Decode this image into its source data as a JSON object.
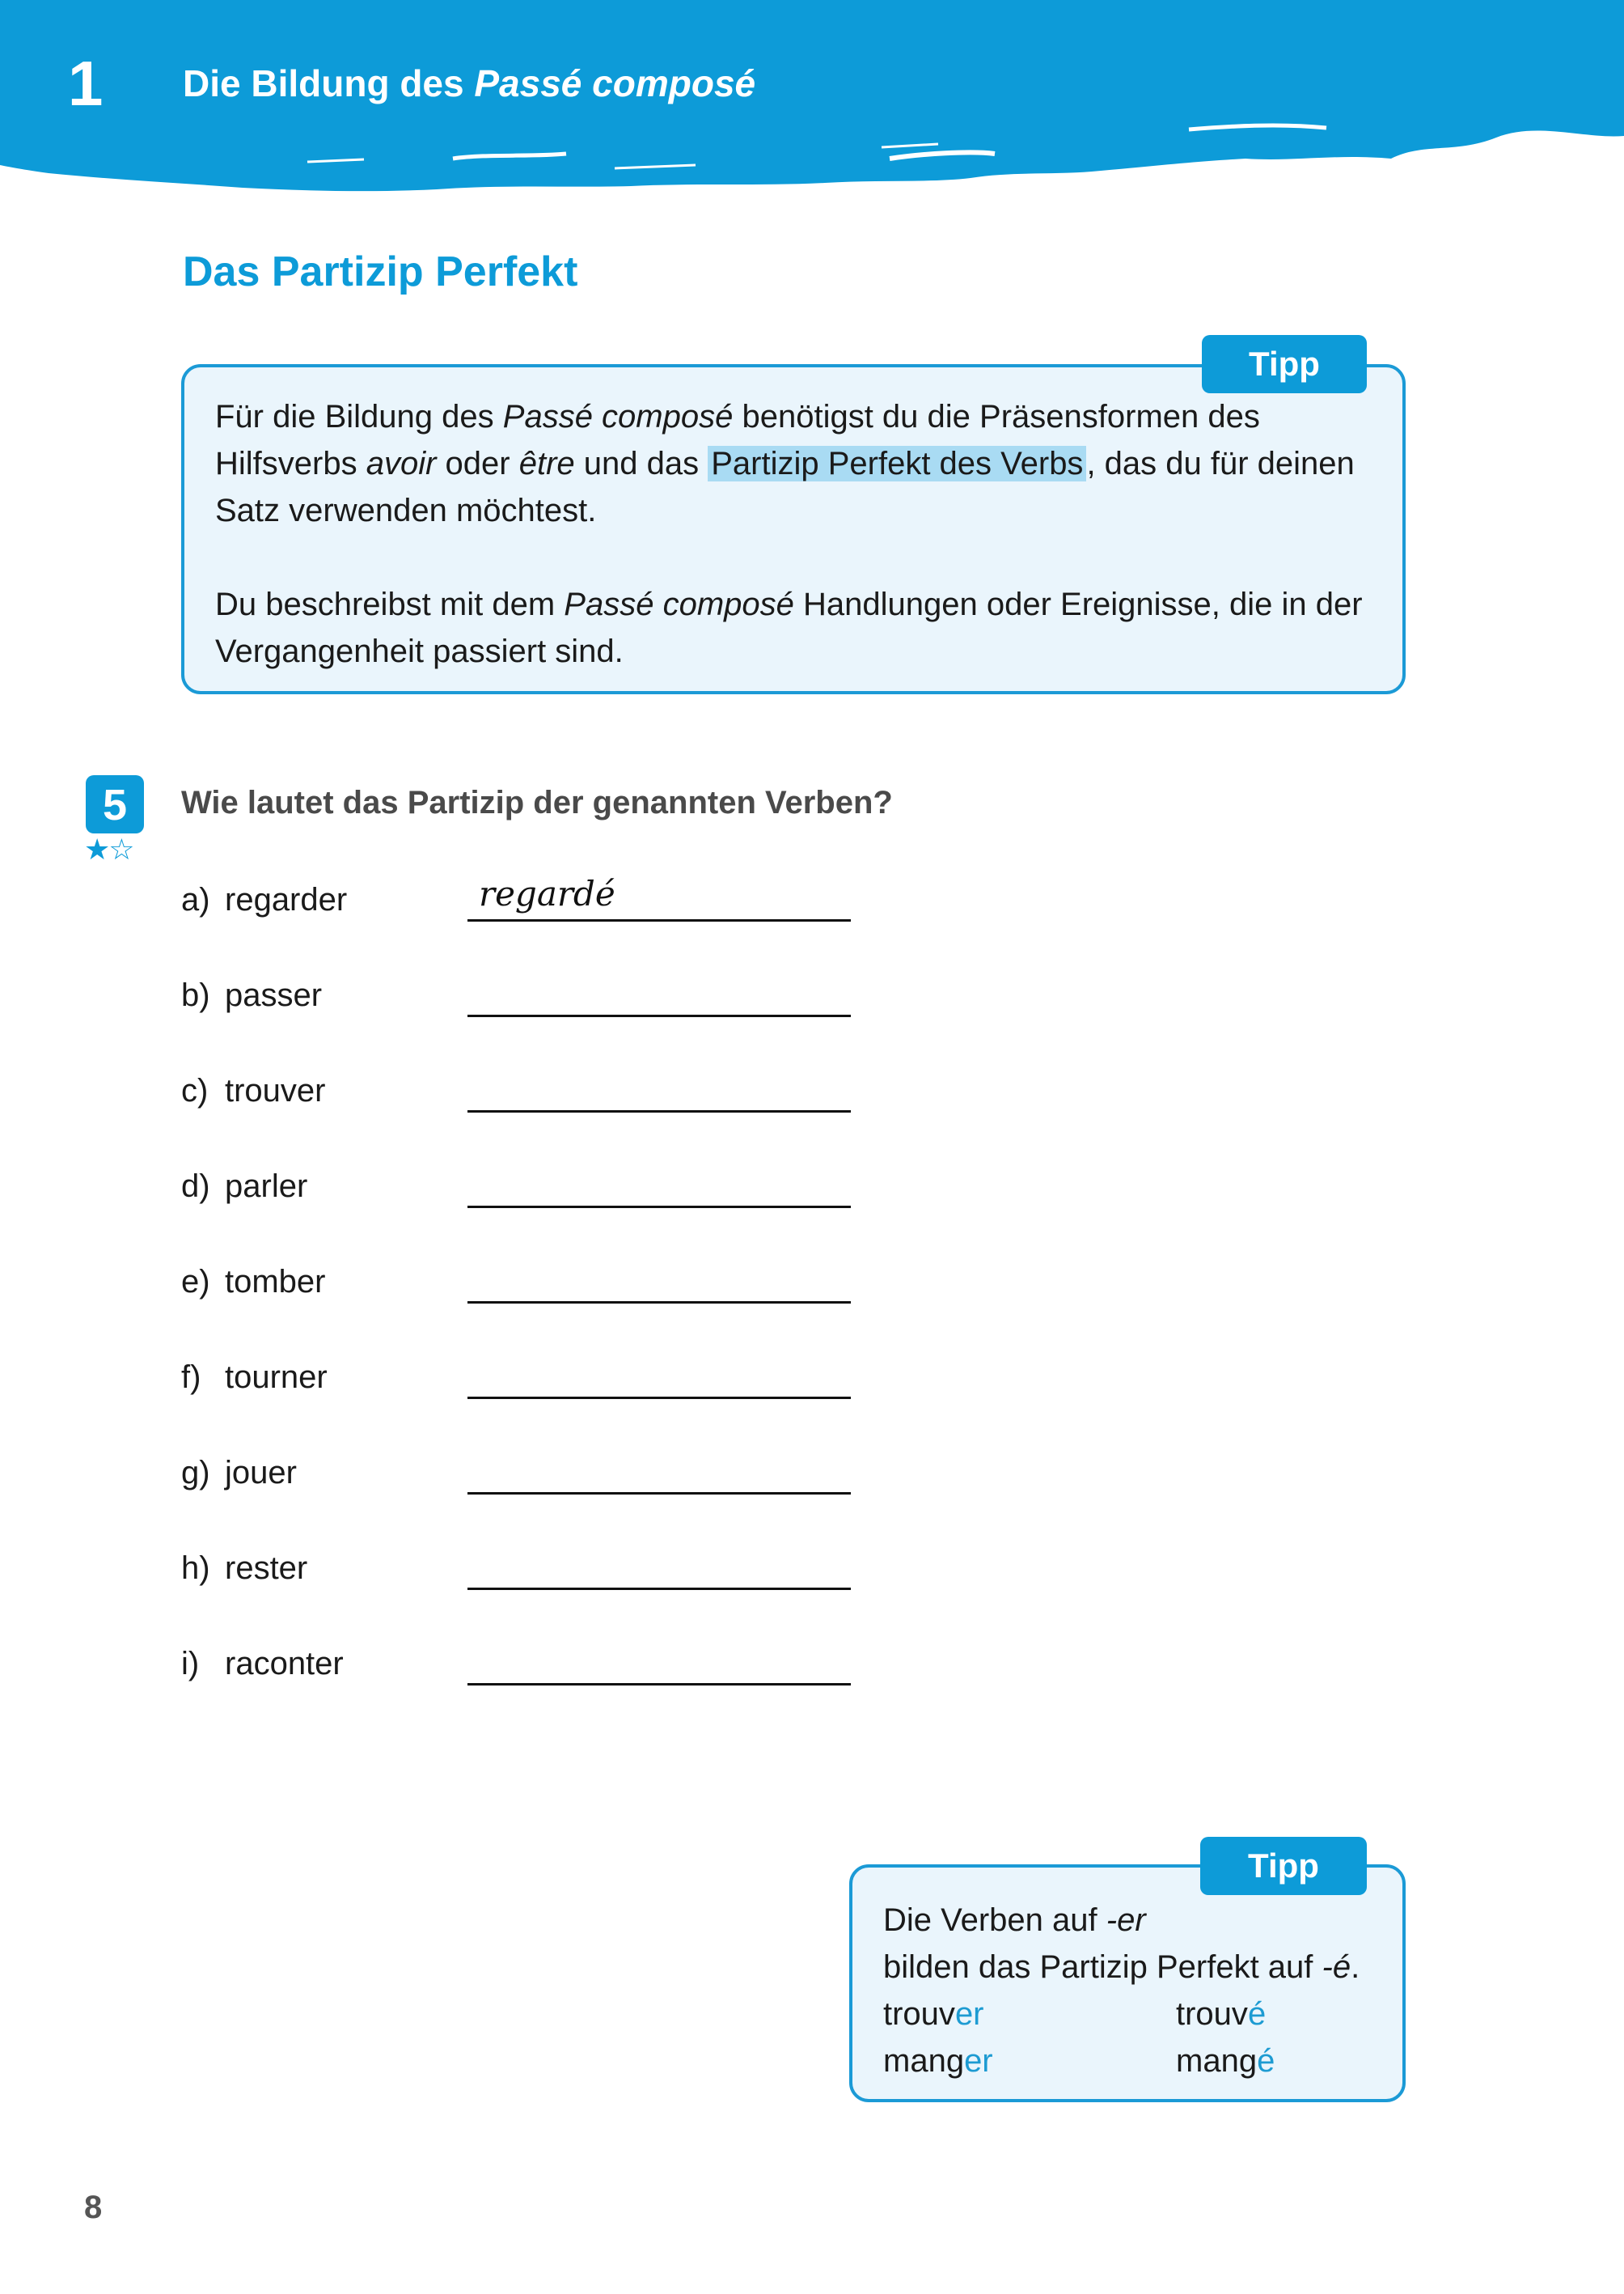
{
  "header": {
    "chapter_number": "1",
    "chapter_title_prefix": "Die Bildung des ",
    "chapter_title_italic": "Passé composé",
    "color": "#0d9bd8"
  },
  "section": {
    "title": "Das Partizip Perfekt"
  },
  "tip_box_1": {
    "tab_label": "Tipp",
    "p1": {
      "t1": "Für die Bildung des ",
      "i1": "Passé composé",
      "t2": " benötigst du die Präsensformen des Hilfsverbs ",
      "i2": "avoir",
      "t3": " oder ",
      "i3": "être",
      "t4": " und das ",
      "highlight": "Partizip Perfekt des Verbs",
      "t5": ", das du für deinen Satz verwenden möchtest."
    },
    "p2": {
      "t1": "Du beschreibst mit dem ",
      "i1": "Passé composé",
      "t2": " Handlungen oder Ereignisse, die in der Vergangenheit passiert sind."
    }
  },
  "exercise": {
    "number": "5",
    "difficulty_stars": "★☆",
    "difficulty": {
      "filled": 1,
      "total": 2
    },
    "question": "Wie lautet das Partizip der genannten Verben?",
    "items": [
      {
        "letter": "a)",
        "verb": "regarder",
        "answer": "regardé"
      },
      {
        "letter": "b)",
        "verb": "passer",
        "answer": ""
      },
      {
        "letter": "c)",
        "verb": "trouver",
        "answer": ""
      },
      {
        "letter": "d)",
        "verb": "parler",
        "answer": ""
      },
      {
        "letter": "e)",
        "verb": "tomber",
        "answer": ""
      },
      {
        "letter": "f)",
        "verb": "tourner",
        "answer": ""
      },
      {
        "letter": "g)",
        "verb": "jouer",
        "answer": ""
      },
      {
        "letter": "h)",
        "verb": "rester",
        "answer": ""
      },
      {
        "letter": "i)",
        "verb": "raconter",
        "answer": ""
      }
    ]
  },
  "tip_box_2": {
    "tab_label": "Tipp",
    "line1_text": "Die Verben auf ",
    "line1_italic": "-er",
    "line2_text": "bilden das Partizip Perfekt auf ",
    "line2_italic": "-é",
    "line2_end": ".",
    "examples": [
      {
        "stem": "trouv",
        "ending": "er",
        "participle_stem": "trouv",
        "participle_ending": "é"
      },
      {
        "stem": "mang",
        "ending": "er",
        "participle_stem": "mang",
        "participle_ending": "é"
      }
    ]
  },
  "page_number": "8"
}
